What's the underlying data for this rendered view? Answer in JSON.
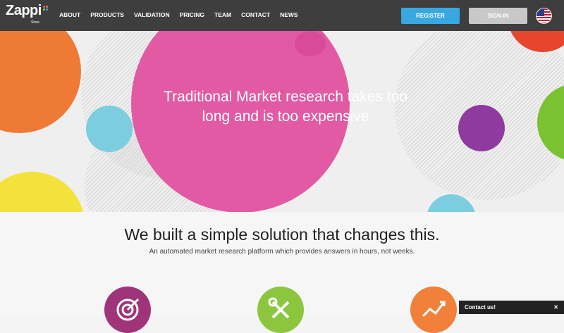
{
  "header": {
    "logo": {
      "brand": "Zappi",
      "sub": "Store"
    },
    "nav": [
      "ABOUT",
      "PRODUCTS",
      "VALIDATION",
      "PRICING",
      "TEAM",
      "CONTACT",
      "NEWS"
    ],
    "register_label": "REGISTER",
    "signin_label": "SIGN-IN",
    "flag_icon": "us-flag-icon"
  },
  "hero": {
    "title": "Traditional Market research takes too long and is too expensive"
  },
  "solution": {
    "heading": "We built a simple solution that changes this.",
    "subheading": "An automated market research platform which provides answers in hours, not weeks.",
    "features": [
      {
        "icon": "target-icon",
        "color": "#a0347a"
      },
      {
        "icon": "tools-icon",
        "color": "#8cc63f"
      },
      {
        "icon": "growth-chart-icon",
        "color": "#f0803a"
      }
    ]
  },
  "contact": {
    "label": "Contact us!",
    "icon": "close-icon"
  },
  "colors": {
    "nav_bg": "#3e3e3e",
    "register": "#3aa8e0",
    "signin": "#c8c8c8",
    "pink": "#e25aa3",
    "orange": "#ee7a35",
    "yellow": "#f2e23b",
    "blue": "#7ccde0",
    "purple": "#8e3a9e",
    "green": "#7ac231",
    "red": "#e8452e"
  }
}
